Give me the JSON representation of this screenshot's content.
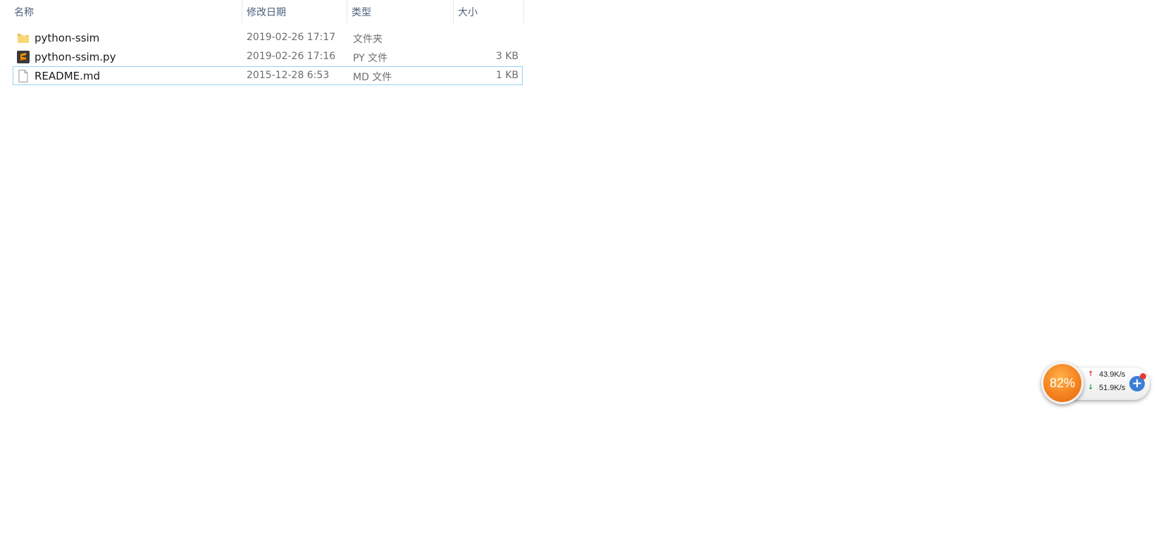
{
  "columns": {
    "name": "名称",
    "date": "修改日期",
    "type": "类型",
    "size": "大小",
    "sort_indicator": "^"
  },
  "files": [
    {
      "name": "python-ssim",
      "date": "2019-02-26 17:17",
      "type": "文件夹",
      "size": "",
      "icon": "folder-icon"
    },
    {
      "name": "python-ssim.py",
      "date": "2019-02-26 17:16",
      "type": "PY 文件",
      "size": "3 KB",
      "icon": "sublime-text-file-icon"
    },
    {
      "name": "README.md",
      "date": "2015-12-28 6:53",
      "type": "MD 文件",
      "size": "1 KB",
      "icon": "document-file-icon"
    }
  ],
  "widget": {
    "percent": "82%",
    "upload": "43.9K/s",
    "download": "51.9K/s",
    "plus": "+"
  },
  "colors": {
    "header_text": "#4c607a",
    "selection_border": "#99d1f3",
    "widget_orange": "#f5821f",
    "upload_arrow": "#e53935",
    "download_arrow": "#2e9e4f"
  }
}
